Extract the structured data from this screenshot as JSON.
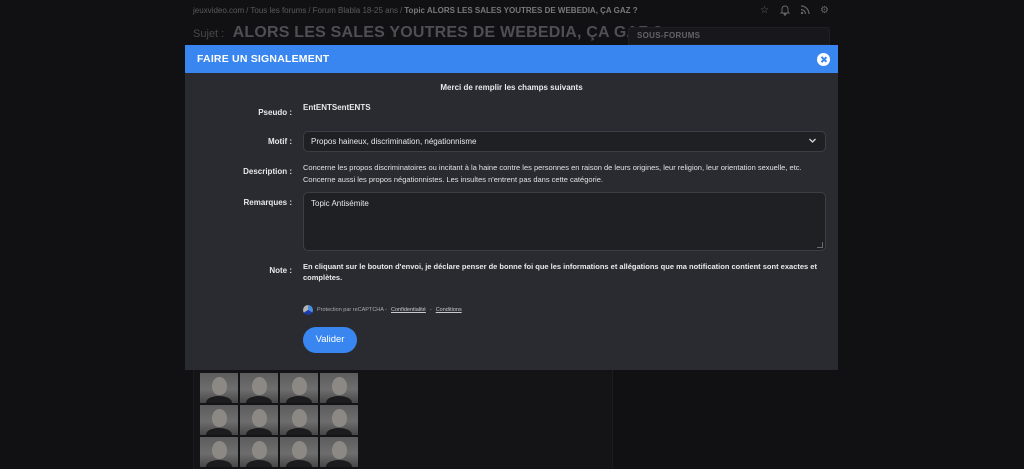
{
  "breadcrumb": {
    "items": [
      "jeuxvideo.com",
      "Tous les forums",
      "Forum Blabla 18-25 ans"
    ],
    "separator": "/",
    "current": "Topic ALORS LES SALES YOUTRES DE WEBEDIA, ÇA GAZ ?"
  },
  "top_icons": [
    "star-icon",
    "bell-icon",
    "rss-icon",
    "gear-icon"
  ],
  "subject": {
    "prefix": "Sujet :",
    "title": "ALORS LES SALES YOUTRES DE WEBEDIA, ÇA GAZ ?"
  },
  "sidebar": {
    "heading": "SOUS-FORUMS"
  },
  "modal": {
    "title": "FAIRE UN SIGNALEMENT",
    "intro": "Merci de remplir les champs suivants",
    "pseudo_label": "Pseudo :",
    "pseudo_value": "EntENTSentENTS",
    "motif_label": "Motif :",
    "motif_value": "Propos haineux, discrimination, négationnisme",
    "description_label": "Description :",
    "description_line1": "Concerne les propos discriminatoires ou incitant à la haine contre les personnes en raison de leurs origines, leur religion, leur orientation sexuelle, etc.",
    "description_line2": "Concerne aussi les propos négationnistes. Les insultes n'entrent pas dans cette catégorie.",
    "remarques_label": "Remarques :",
    "remarques_value": "Topic Antisémite",
    "note_label": "Note :",
    "note_text": "En cliquant sur le bouton d'envoi, je déclare penser de bonne foi que les informations et allégations que ma notification contient sont exactes et complètes.",
    "recaptcha_text": "Protection par reCAPTCHA -",
    "recaptcha_link1": "Confidentialité",
    "recaptcha_dash": "-",
    "recaptcha_link2": "Conditions",
    "submit_label": "Valider"
  },
  "colors": {
    "accent": "#3a86f0",
    "background": "#1b1b1e",
    "modal_background": "#2a2b30"
  }
}
